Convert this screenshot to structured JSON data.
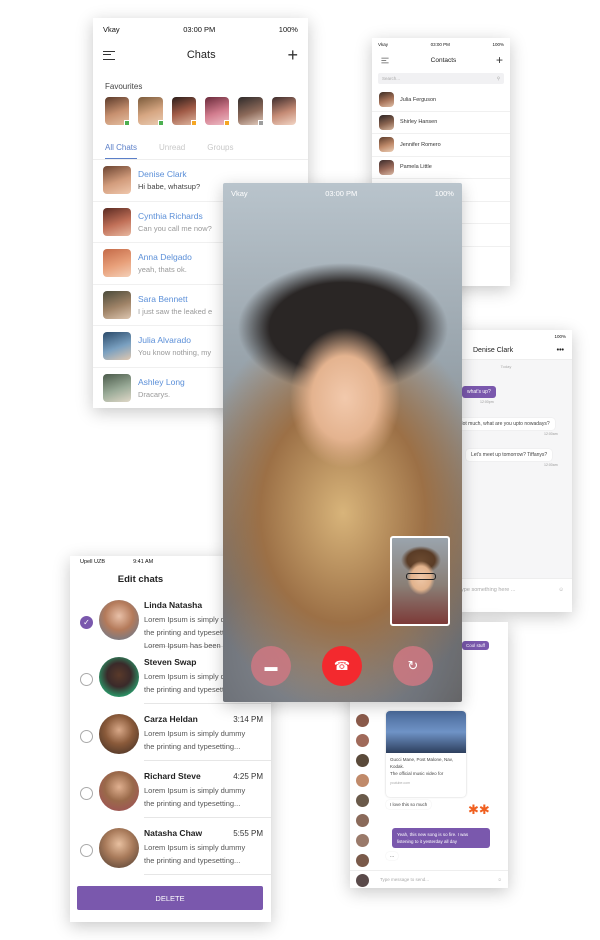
{
  "chats_screen": {
    "status": {
      "carrier": "Vkay",
      "time": "03:00 PM",
      "battery": "100%"
    },
    "title": "Chats",
    "favourites_label": "Favourites",
    "tabs": [
      "All Chats",
      "Unread",
      "Groups"
    ],
    "rows": [
      {
        "name": "Denise Clark",
        "message": "Hi babe, whatsup?"
      },
      {
        "name": "Cynthia Richards",
        "message": "Can you call me now?"
      },
      {
        "name": "Anna Delgado",
        "message": "yeah, thats ok."
      },
      {
        "name": "Sara Bennett",
        "message": "I just saw the leaked e"
      },
      {
        "name": "Julia Alvarado",
        "message": "You know nothing, my"
      },
      {
        "name": "Ashley Long",
        "message": "Dracarys."
      }
    ]
  },
  "contacts_screen": {
    "status": {
      "carrier": "Vkay",
      "time": "03:00 PM",
      "battery": "100%"
    },
    "title": "Contacts",
    "search_placeholder": "Search...",
    "rows": [
      "Julia Ferguson",
      "Shirley Hansen",
      "Jennifer Romero",
      "Pamela Little"
    ]
  },
  "call_screen": {
    "status": {
      "carrier": "Vkay",
      "time": "03:00 PM",
      "battery": "100%"
    }
  },
  "dm_screen": {
    "status": {
      "battery": "100%"
    },
    "title": "Denise Clark",
    "day": "Today",
    "messages": [
      {
        "text": "what's up?",
        "time": "12:00pm"
      },
      {
        "text": "Not much, what are you upto nowadays?",
        "time": "12:00am"
      },
      {
        "text": "Let's meet up tomorrow? Tiffanys?",
        "time": "12:00am"
      }
    ],
    "input_placeholder": "Type something here ..."
  },
  "group_screen": {
    "top_bubble": "Cool stuff",
    "media_caption": "Gucci Mane, Post Malone, Nav, Kodak.",
    "media_caption2": "The official music video for",
    "media_source": "youtube.com",
    "love_text": "I love this so much",
    "reply_text": "Yeah, this new song is so fire. I was listening to it yesterday all day",
    "typing": "...",
    "input_placeholder": "Type message to send..."
  },
  "edit_screen": {
    "status": {
      "carrier": "Upell UZB",
      "time": "9:41 AM"
    },
    "title": "Edit chats",
    "rows": [
      {
        "name": "Linda Natasha",
        "time": "",
        "line1": "Lorem Ipsum is simply dummy",
        "line2": "the printing and typesetting...",
        "line3": "Lorem Ipsum has been",
        "checked": true
      },
      {
        "name": "Steven Swap",
        "time": "",
        "line1": "Lorem Ipsum is simply dummy",
        "line2": "the printing and typesetting...",
        "line3": "",
        "checked": false
      },
      {
        "name": "Carza Heldan",
        "time": "3:14 PM",
        "line1": "Lorem Ipsum is simply dummy",
        "line2": "the printing and typesetting...",
        "line3": "",
        "checked": false
      },
      {
        "name": "Richard Steve",
        "time": "4:25 PM",
        "line1": "Lorem Ipsum is simply dummy",
        "line2": "the printing and typesetting...",
        "line3": "",
        "checked": false
      },
      {
        "name": "Natasha Chaw",
        "time": "5:55 PM",
        "line1": "Lorem Ipsum is simply dummy",
        "line2": "the printing and typesetting...",
        "line3": "",
        "checked": false
      }
    ],
    "delete_label": "DELETE"
  },
  "icons": {
    "chat_bubble": "▬",
    "end_call": "☎",
    "camera_switch": "↻"
  },
  "colors": {
    "accent": "#7a58ad",
    "link": "#5b8fd8",
    "end_call": "#f3292e"
  }
}
